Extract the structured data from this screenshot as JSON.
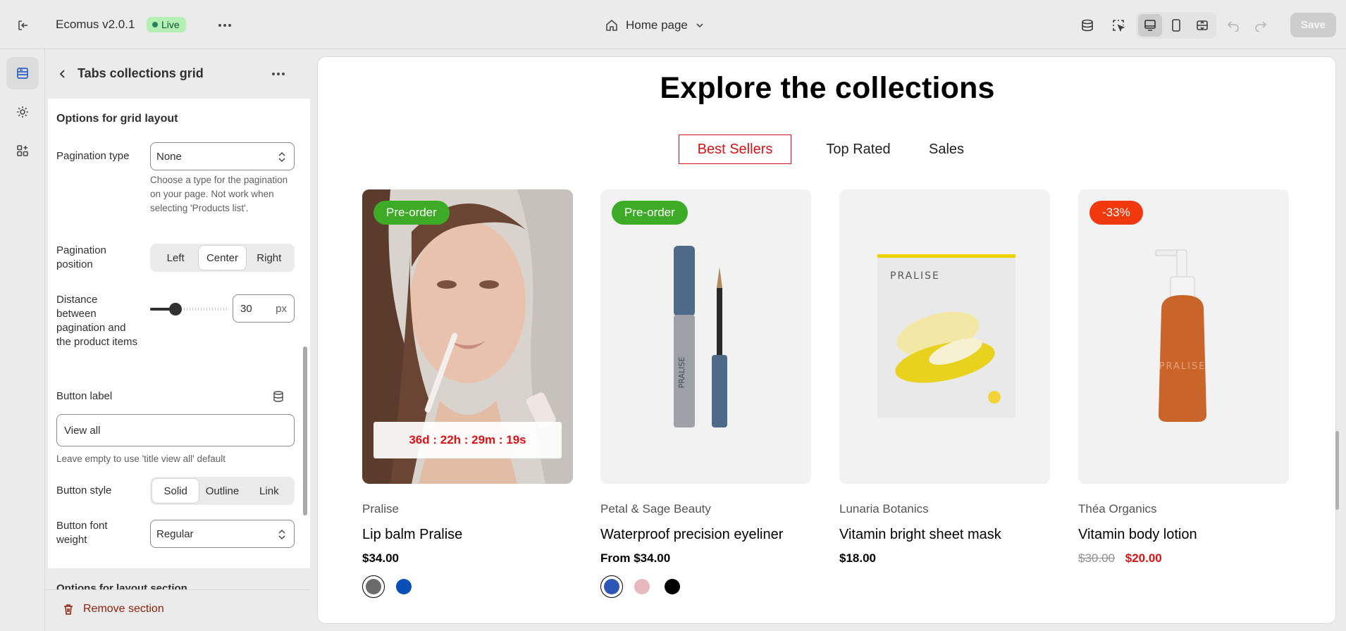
{
  "topbar": {
    "app_title": "Ecomus v2.0.1",
    "status": "Live",
    "page_selector": "Home page",
    "save_label": "Save"
  },
  "panel": {
    "title": "Tabs collections grid",
    "section_title": "Options for grid layout",
    "pagination_type": {
      "label": "Pagination type",
      "value": "None",
      "help": "Choose a type for the pagination on your page. Not work when selecting 'Products list'."
    },
    "pagination_position": {
      "label": "Pagination position",
      "options": [
        "Left",
        "Center",
        "Right"
      ],
      "selected": "Center"
    },
    "distance": {
      "label": "Distance between pagination and the product items",
      "value": "30",
      "unit": "px"
    },
    "button_label": {
      "label": "Button label",
      "value": "View all",
      "help": "Leave empty to use 'title view all' default"
    },
    "button_style": {
      "label": "Button style",
      "options": [
        "Solid",
        "Outline",
        "Link"
      ],
      "selected": "Solid"
    },
    "button_font_weight": {
      "label": "Button font weight",
      "value": "Regular"
    },
    "next_section_title": "Options for layout section",
    "remove_label": "Remove section"
  },
  "preview": {
    "heading": "Explore the collections",
    "tabs": [
      "Best Sellers",
      "Top Rated",
      "Sales"
    ],
    "active_tab": "Best Sellers",
    "products": [
      {
        "badge": "Pre-order",
        "badge_color": "#3dab25",
        "countdown": "36d : 22h : 29m : 19s",
        "vendor": "Pralise",
        "name": "Lip balm Pralise",
        "price": "$34.00",
        "swatches": [
          "#6b6b6b",
          "#0a4fb5"
        ]
      },
      {
        "badge": "Pre-order",
        "badge_color": "#3dab25",
        "vendor": "Petal & Sage Beauty",
        "name": "Waterproof precision eyeliner",
        "price": "From $34.00",
        "swatches": [
          "#2e55b8",
          "#e8b8bf",
          "#000000"
        ]
      },
      {
        "vendor": "Lunaria Botanics",
        "name": "Vitamin bright sheet mask",
        "price": "$18.00"
      },
      {
        "badge": "-33%",
        "badge_color": "#f2390d",
        "vendor": "Théa Organics",
        "name": "Vitamin body lotion",
        "old_price": "$30.00",
        "price": "$20.00"
      }
    ]
  }
}
